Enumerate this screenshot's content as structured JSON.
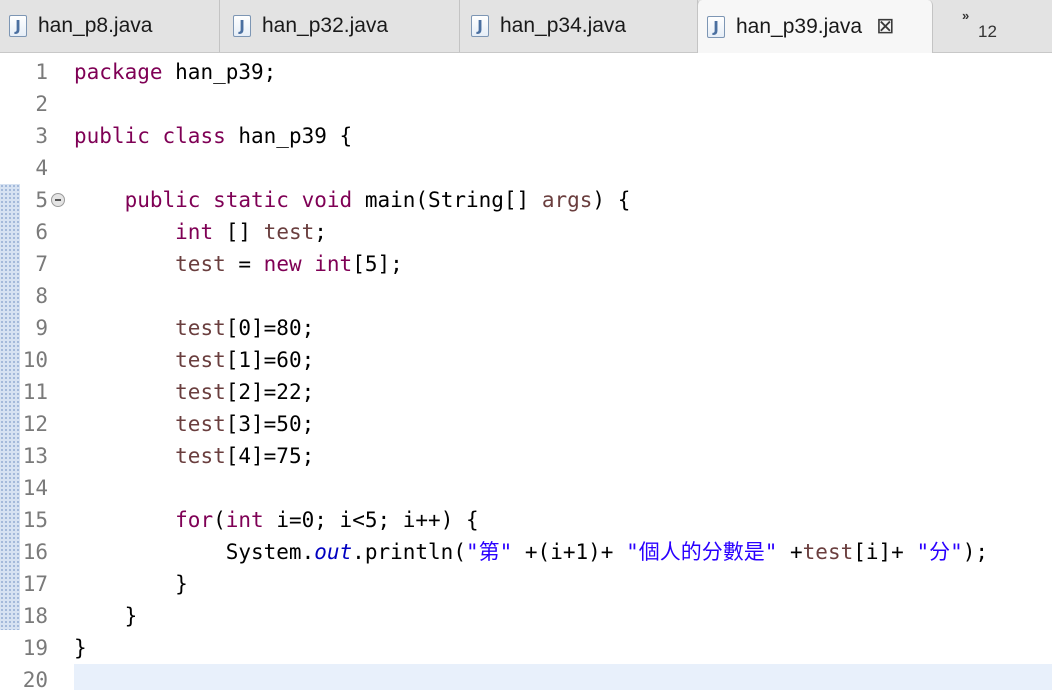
{
  "tabs": [
    {
      "label": "han_p8.java",
      "active": false
    },
    {
      "label": "han_p32.java",
      "active": false
    },
    {
      "label": "han_p34.java",
      "active": false
    },
    {
      "label": "han_p39.java",
      "active": true
    }
  ],
  "tab_overflow": {
    "chevron": "»",
    "count": "12"
  },
  "icons": {
    "file_icon": "java-file-icon",
    "file_icon_glyph": "J",
    "close_icon": "close-icon",
    "close_glyph": "⊠"
  },
  "colors": {
    "keyword": "#7f0055",
    "string": "#2a00ff",
    "static_field": "#0000c0",
    "current_line": "#e8f0fb"
  },
  "line_numbers": [
    "1",
    "2",
    "3",
    "4",
    "5",
    "6",
    "7",
    "8",
    "9",
    "10",
    "11",
    "12",
    "13",
    "14",
    "15",
    "16",
    "17",
    "18",
    "19",
    "20"
  ],
  "code": {
    "l1": {
      "kw": "package",
      "rest": " han_p39;"
    },
    "l3": {
      "kw1": "public",
      "kw2": "class",
      "rest": " han_p39 {"
    },
    "l5": {
      "indent": "    ",
      "kw1": "public",
      "kw2": "static",
      "kw3": "void",
      "mid": " main(String[] ",
      "var": "args",
      "rest": ") {"
    },
    "l6": {
      "indent": "        ",
      "kw": "int",
      "mid": " [] ",
      "var": "test",
      "rest": ";"
    },
    "l7": {
      "indent": "        ",
      "var": "test",
      "mid": " = ",
      "kw1": "new",
      "kw2": "int",
      "rest": "[5];"
    },
    "l9": {
      "indent": "        ",
      "var": "test",
      "rest": "[0]=80;"
    },
    "l10": {
      "indent": "        ",
      "var": "test",
      "rest": "[1]=60;"
    },
    "l11": {
      "indent": "        ",
      "var": "test",
      "rest": "[2]=22;"
    },
    "l12": {
      "indent": "        ",
      "var": "test",
      "rest": "[3]=50;"
    },
    "l13": {
      "indent": "        ",
      "var": "test",
      "rest": "[4]=75;"
    },
    "l15": {
      "indent": "        ",
      "kw1": "for",
      "p1": "(",
      "kw2": "int",
      "p2": " i=0; i<5; i++) {"
    },
    "l16": {
      "indent": "            ",
      "a": "System.",
      "field": "out",
      "b": ".println(",
      "s1": "\"第\"",
      "c": " +(i+1)+ ",
      "s2": "\"個人的分數是\"",
      "d": " +",
      "var": "test",
      "e": "[i]+ ",
      "s3": "\"分\"",
      "f": ");"
    },
    "l17": {
      "text": "        }"
    },
    "l18": {
      "text": "    }"
    },
    "l19": {
      "text": "}"
    }
  }
}
